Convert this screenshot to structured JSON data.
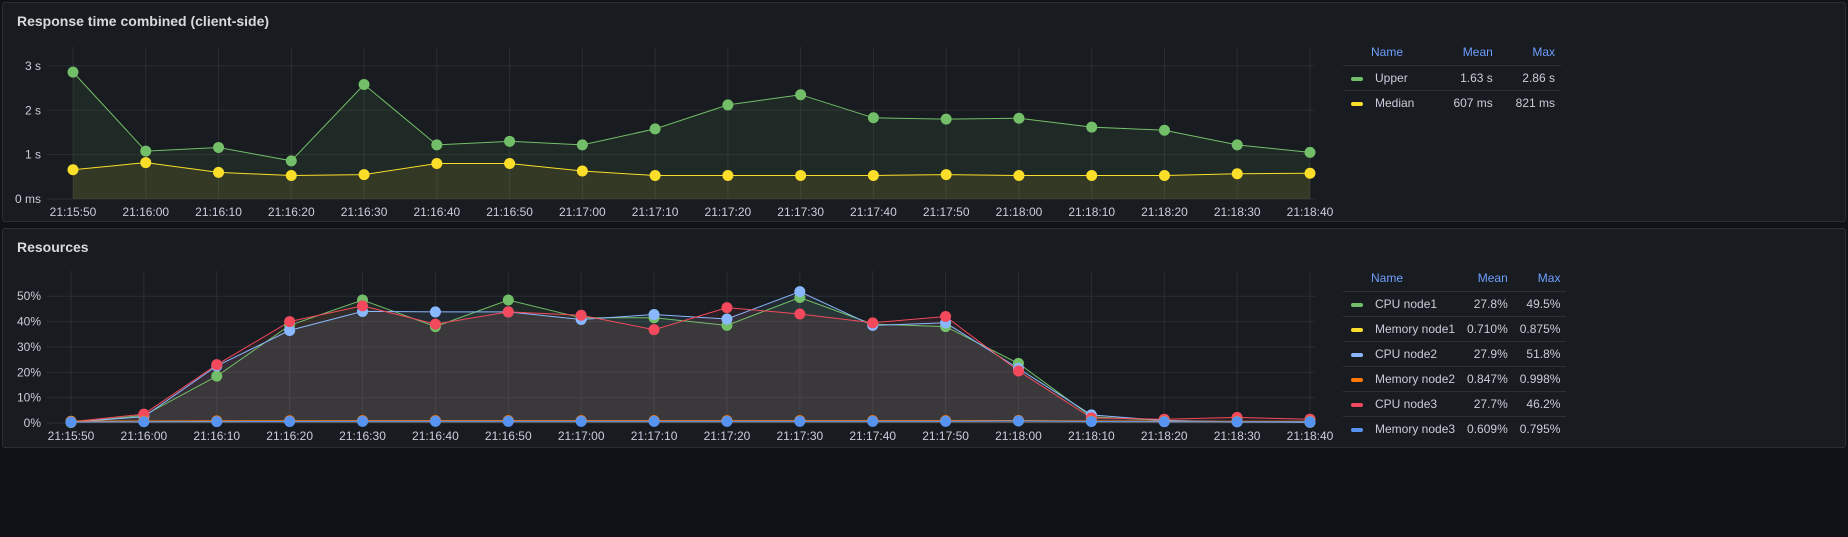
{
  "panels": [
    {
      "title": "Response time combined (client-side)",
      "legend": {
        "headers": {
          "name": "Name",
          "mean": "Mean",
          "max": "Max"
        },
        "rows": [
          {
            "name": "Upper",
            "mean": "1.63 s",
            "max": "2.86 s",
            "color": "#73bf69"
          },
          {
            "name": "Median",
            "mean": "607 ms",
            "max": "821 ms",
            "color": "#fade2a"
          }
        ]
      },
      "chart_data": {
        "type": "line",
        "x": [
          "21:15:50",
          "21:15:55",
          "21:16:00",
          "21:16:05",
          "21:16:10",
          "21:16:15",
          "21:16:20",
          "21:16:25",
          "21:16:30",
          "21:16:35",
          "21:16:40",
          "21:16:45",
          "21:16:50",
          "21:16:55",
          "21:17:00",
          "21:17:05",
          "21:17:10",
          "21:17:15",
          "21:17:20",
          "21:17:25",
          "21:17:30",
          "21:17:35",
          "21:17:40",
          "21:17:45",
          "21:17:50",
          "21:17:55",
          "21:18:00",
          "21:18:05",
          "21:18:10",
          "21:18:15",
          "21:18:20",
          "21:18:25",
          "21:18:30",
          "21:18:35",
          "21:18:40"
        ],
        "x_ticks": [
          "21:15:50",
          "21:16:00",
          "21:16:10",
          "21:16:20",
          "21:16:30",
          "21:16:40",
          "21:16:50",
          "21:17:00",
          "21:17:10",
          "21:17:20",
          "21:17:30",
          "21:17:40",
          "21:17:50",
          "21:18:00",
          "21:18:10",
          "21:18:20",
          "21:18:30",
          "21:18:40"
        ],
        "y_ticks": [
          {
            "value": 0,
            "label": "0 ms"
          },
          {
            "value": 1,
            "label": "1 s"
          },
          {
            "value": 2,
            "label": "2 s"
          },
          {
            "value": 3,
            "label": "3 s"
          }
        ],
        "ylim": [
          0,
          3.2
        ],
        "unit": "s",
        "grid": true,
        "legend_position": "right",
        "series": [
          {
            "name": "Upper",
            "color": "#73bf69",
            "points": [
              [
                "21:15:50",
                2.86
              ],
              [
                "21:16:00",
                1.08
              ],
              [
                "21:16:10",
                1.16
              ],
              [
                "21:16:20",
                0.86
              ],
              [
                "21:16:30",
                2.58
              ],
              [
                "21:16:40",
                1.22
              ],
              [
                "21:16:50",
                1.3
              ],
              [
                "21:17:00",
                1.22
              ],
              [
                "21:17:10",
                1.58
              ],
              [
                "21:17:20",
                2.12
              ],
              [
                "21:17:30",
                2.35
              ],
              [
                "21:17:40",
                1.83
              ],
              [
                "21:17:50",
                1.8
              ],
              [
                "21:18:00",
                1.82
              ],
              [
                "21:18:10",
                1.62
              ],
              [
                "21:18:20",
                1.55
              ],
              [
                "21:18:30",
                1.22
              ],
              [
                "21:18:40",
                1.05
              ]
            ]
          },
          {
            "name": "Median",
            "color": "#fade2a",
            "points": [
              [
                "21:15:50",
                0.66
              ],
              [
                "21:16:00",
                0.821
              ],
              [
                "21:16:10",
                0.6
              ],
              [
                "21:16:20",
                0.53
              ],
              [
                "21:16:30",
                0.55
              ],
              [
                "21:16:40",
                0.8
              ],
              [
                "21:16:50",
                0.8
              ],
              [
                "21:17:00",
                0.63
              ],
              [
                "21:17:10",
                0.53
              ],
              [
                "21:17:20",
                0.53
              ],
              [
                "21:17:30",
                0.53
              ],
              [
                "21:17:40",
                0.53
              ],
              [
                "21:17:50",
                0.55
              ],
              [
                "21:18:00",
                0.53
              ],
              [
                "21:18:10",
                0.53
              ],
              [
                "21:18:20",
                0.53
              ],
              [
                "21:18:30",
                0.57
              ],
              [
                "21:18:40",
                0.58
              ]
            ]
          }
        ]
      }
    },
    {
      "title": "Resources",
      "legend": {
        "headers": {
          "name": "Name",
          "mean": "Mean",
          "max": "Max"
        },
        "rows": [
          {
            "name": "CPU node1",
            "mean": "27.8%",
            "max": "49.5%",
            "color": "#73bf69"
          },
          {
            "name": "Memory node1",
            "mean": "0.710%",
            "max": "0.875%",
            "color": "#fade2a"
          },
          {
            "name": "CPU node2",
            "mean": "27.9%",
            "max": "51.8%",
            "color": "#8ab8ff"
          },
          {
            "name": "Memory node2",
            "mean": "0.847%",
            "max": "0.998%",
            "color": "#ff780a"
          },
          {
            "name": "CPU node3",
            "mean": "27.7%",
            "max": "46.2%",
            "color": "#f2495c"
          },
          {
            "name": "Memory node3",
            "mean": "0.609%",
            "max": "0.795%",
            "color": "#5794f2"
          }
        ]
      },
      "chart_data": {
        "type": "line",
        "x": [
          "21:15:50",
          "21:15:55",
          "21:16:00",
          "21:16:05",
          "21:16:10",
          "21:16:15",
          "21:16:20",
          "21:16:25",
          "21:16:30",
          "21:16:35",
          "21:16:40",
          "21:16:45",
          "21:16:50",
          "21:16:55",
          "21:17:00",
          "21:17:05",
          "21:17:10",
          "21:17:15",
          "21:17:20",
          "21:17:25",
          "21:17:30",
          "21:17:35",
          "21:17:40",
          "21:17:45",
          "21:17:50",
          "21:17:55",
          "21:18:00",
          "21:18:05",
          "21:18:10",
          "21:18:15",
          "21:18:20",
          "21:18:25",
          "21:18:30",
          "21:18:35",
          "21:18:40"
        ],
        "x_ticks": [
          "21:15:50",
          "21:16:00",
          "21:16:10",
          "21:16:20",
          "21:16:30",
          "21:16:40",
          "21:16:50",
          "21:17:00",
          "21:17:10",
          "21:17:20",
          "21:17:30",
          "21:17:40",
          "21:17:50",
          "21:18:00",
          "21:18:10",
          "21:18:20",
          "21:18:30",
          "21:18:40"
        ],
        "y_ticks": [
          {
            "value": 0,
            "label": "0%"
          },
          {
            "value": 10,
            "label": "10%"
          },
          {
            "value": 20,
            "label": "20%"
          },
          {
            "value": 30,
            "label": "30%"
          },
          {
            "value": 40,
            "label": "40%"
          },
          {
            "value": 50,
            "label": "50%"
          }
        ],
        "ylim": [
          0,
          56
        ],
        "unit": "%",
        "grid": true,
        "legend_position": "right",
        "series": [
          {
            "name": "CPU node1",
            "color": "#73bf69",
            "points": [
              [
                "21:15:50",
                0.2
              ],
              [
                "21:16:00",
                3.0
              ],
              [
                "21:16:10",
                18.5
              ],
              [
                "21:16:20",
                38.5
              ],
              [
                "21:16:30",
                48.5
              ],
              [
                "21:16:40",
                38.0
              ],
              [
                "21:16:50",
                48.5
              ],
              [
                "21:17:00",
                41.5
              ],
              [
                "21:17:10",
                41.5
              ],
              [
                "21:17:20",
                38.5
              ],
              [
                "21:17:30",
                49.5
              ],
              [
                "21:17:40",
                39.0
              ],
              [
                "21:17:50",
                38.0
              ],
              [
                "21:18:00",
                23.5
              ],
              [
                "21:18:10",
                2.5
              ],
              [
                "21:18:20",
                1.0
              ],
              [
                "21:18:30",
                0.5
              ],
              [
                "21:18:40",
                0.3
              ]
            ]
          },
          {
            "name": "CPU node2",
            "color": "#8ab8ff",
            "points": [
              [
                "21:15:50",
                0.3
              ],
              [
                "21:16:00",
                2.5
              ],
              [
                "21:16:10",
                22.5
              ],
              [
                "21:16:20",
                36.5
              ],
              [
                "21:16:30",
                44.0
              ],
              [
                "21:16:40",
                43.8
              ],
              [
                "21:16:50",
                43.8
              ],
              [
                "21:17:00",
                40.8
              ],
              [
                "21:17:10",
                42.8
              ],
              [
                "21:17:20",
                41.0
              ],
              [
                "21:17:30",
                51.8
              ],
              [
                "21:17:40",
                38.5
              ],
              [
                "21:17:50",
                39.5
              ],
              [
                "21:18:00",
                21.5
              ],
              [
                "21:18:10",
                3.2
              ],
              [
                "21:18:20",
                1.0
              ],
              [
                "21:18:30",
                0.5
              ],
              [
                "21:18:40",
                0.3
              ]
            ]
          },
          {
            "name": "CPU node3",
            "color": "#f2495c",
            "points": [
              [
                "21:15:50",
                0.5
              ],
              [
                "21:16:00",
                3.5
              ],
              [
                "21:16:10",
                23.0
              ],
              [
                "21:16:20",
                40.0
              ],
              [
                "21:16:30",
                46.2
              ],
              [
                "21:16:40",
                39.0
              ],
              [
                "21:16:50",
                43.8
              ],
              [
                "21:17:00",
                42.5
              ],
              [
                "21:17:10",
                36.8
              ],
              [
                "21:17:20",
                45.5
              ],
              [
                "21:17:30",
                43.0
              ],
              [
                "21:17:40",
                39.5
              ],
              [
                "21:17:50",
                42.0
              ],
              [
                "21:18:00",
                20.5
              ],
              [
                "21:18:10",
                2.0
              ],
              [
                "21:18:20",
                1.5
              ],
              [
                "21:18:30",
                2.2
              ],
              [
                "21:18:40",
                1.5
              ]
            ]
          },
          {
            "name": "Memory node1",
            "color": "#fade2a",
            "points": [
              [
                "21:15:50",
                0.6
              ],
              [
                "21:16:00",
                0.7
              ],
              [
                "21:16:10",
                0.7
              ],
              [
                "21:16:20",
                0.75
              ],
              [
                "21:16:30",
                0.8
              ],
              [
                "21:16:40",
                0.8
              ],
              [
                "21:16:50",
                0.8
              ],
              [
                "21:17:00",
                0.8
              ],
              [
                "21:17:10",
                0.8
              ],
              [
                "21:17:20",
                0.8
              ],
              [
                "21:17:30",
                0.8
              ],
              [
                "21:17:40",
                0.8
              ],
              [
                "21:17:50",
                0.8
              ],
              [
                "21:18:00",
                0.875
              ],
              [
                "21:18:10",
                0.7
              ],
              [
                "21:18:20",
                0.6
              ],
              [
                "21:18:30",
                0.6
              ],
              [
                "21:18:40",
                0.6
              ]
            ]
          },
          {
            "name": "Memory node2",
            "color": "#ff780a",
            "points": [
              [
                "21:15:50",
                0.7
              ],
              [
                "21:16:00",
                0.8
              ],
              [
                "21:16:10",
                0.85
              ],
              [
                "21:16:20",
                0.9
              ],
              [
                "21:16:30",
                0.95
              ],
              [
                "21:16:40",
                0.95
              ],
              [
                "21:16:50",
                0.95
              ],
              [
                "21:17:00",
                0.95
              ],
              [
                "21:17:10",
                0.95
              ],
              [
                "21:17:20",
                0.95
              ],
              [
                "21:17:30",
                0.95
              ],
              [
                "21:17:40",
                0.95
              ],
              [
                "21:17:50",
                0.95
              ],
              [
                "21:18:00",
                0.998
              ],
              [
                "21:18:10",
                0.8
              ],
              [
                "21:18:20",
                0.7
              ],
              [
                "21:18:30",
                0.7
              ],
              [
                "21:18:40",
                0.7
              ]
            ]
          },
          {
            "name": "Memory node3",
            "color": "#5794f2",
            "points": [
              [
                "21:15:50",
                0.4
              ],
              [
                "21:16:00",
                0.5
              ],
              [
                "21:16:10",
                0.55
              ],
              [
                "21:16:20",
                0.6
              ],
              [
                "21:16:30",
                0.65
              ],
              [
                "21:16:40",
                0.65
              ],
              [
                "21:16:50",
                0.65
              ],
              [
                "21:17:00",
                0.65
              ],
              [
                "21:17:10",
                0.65
              ],
              [
                "21:17:20",
                0.65
              ],
              [
                "21:17:30",
                0.65
              ],
              [
                "21:17:40",
                0.65
              ],
              [
                "21:17:50",
                0.65
              ],
              [
                "21:18:00",
                0.795
              ],
              [
                "21:18:10",
                0.6
              ],
              [
                "21:18:20",
                0.5
              ],
              [
                "21:18:30",
                0.5
              ],
              [
                "21:18:40",
                0.5
              ]
            ]
          }
        ]
      }
    }
  ]
}
